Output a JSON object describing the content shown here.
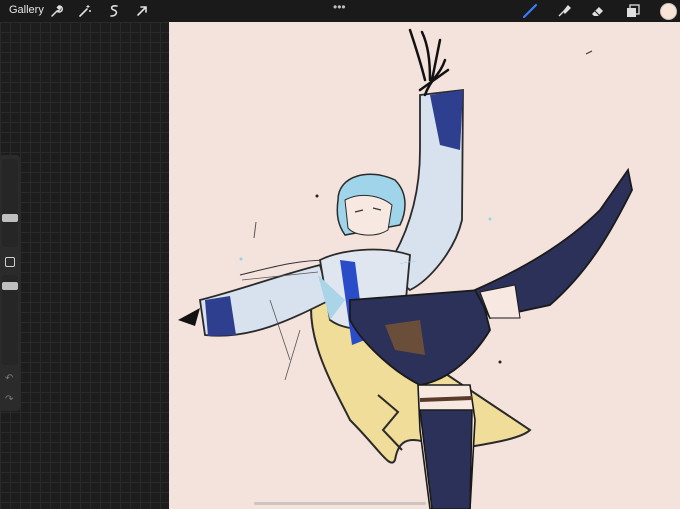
{
  "toolbar": {
    "gallery_label": "Gallery",
    "left_tools": [
      "wrench-icon",
      "magic-wand-icon",
      "selection-icon",
      "transform-arrow-icon"
    ],
    "right_tools": [
      "brush-icon",
      "smudge-icon",
      "eraser-icon",
      "layers-icon"
    ],
    "more_dots": "•••",
    "current_color": "#f7e4d6",
    "active_tool_color": "#3b7cff"
  },
  "sidebar": {
    "brush_size_label": "brush-size",
    "opacity_label": "opacity",
    "undo_glyph": "↶",
    "redo_glyph": "↷"
  },
  "canvas": {
    "background": "#f4e3dc"
  }
}
